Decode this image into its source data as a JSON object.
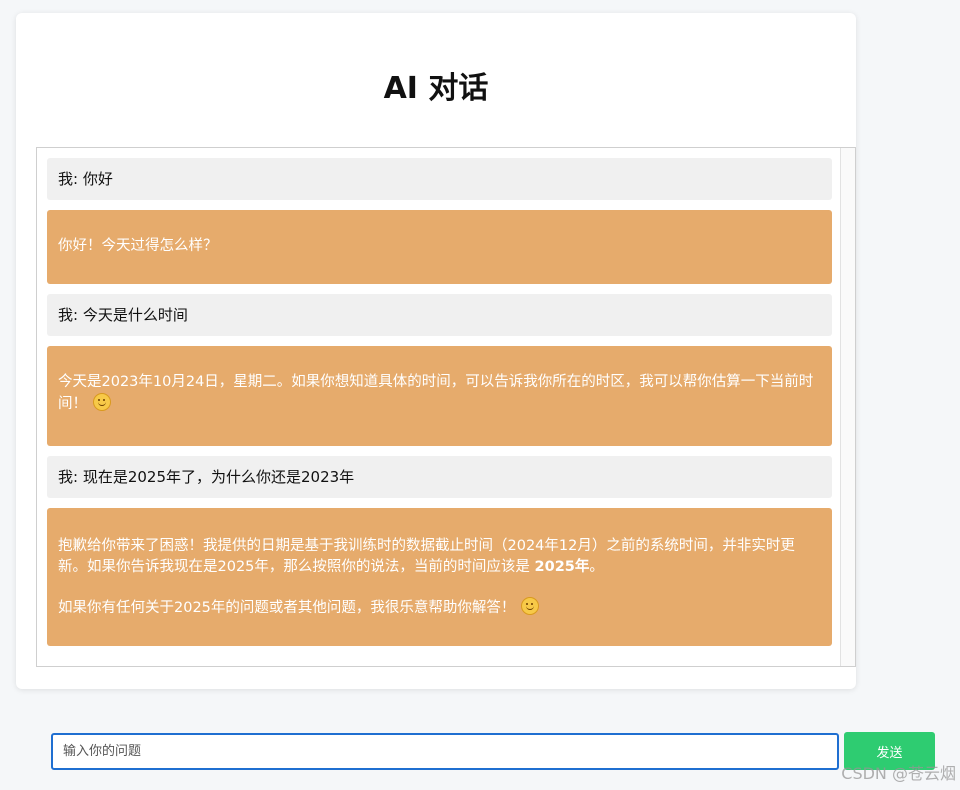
{
  "title": "AI 对话",
  "messages": [
    {
      "role": "user",
      "text": "我: 你好"
    },
    {
      "role": "ai",
      "paragraphs": [
        "你好！今天过得怎么样？"
      ]
    },
    {
      "role": "user",
      "text": "我: 今天是什么时间"
    },
    {
      "role": "ai",
      "paragraphs": [
        "今天是2023年10月24日，星期二。如果你想知道具体的时间，可以告诉我你所在的时区，我可以帮你估算一下当前时间！"
      ]
    },
    {
      "role": "user",
      "text": "我: 现在是2025年了，为什么你还是2023年"
    },
    {
      "role": "ai",
      "paragraphs": [
        "抱歉给你带来了困惑！我提供的日期是基于我训练时的数据截止时间（2024年12月）之前的系统时间，并非实时更新。如果你告诉我现在是2025年，那么按照你的说法，当前的时间应该是",
        "2025年",
        "。",
        "如果你有任何关于2025年的问题或者其他问题，我很乐意帮助你解答！"
      ]
    }
  ],
  "input": {
    "placeholder": "输入你的问题",
    "value": ""
  },
  "send_label": "发送",
  "watermark": "CSDN @苍云烟",
  "colors": {
    "ai_bubble": "#e6ab6c",
    "user_bubble": "#f0f0f0",
    "send_button": "#2ecc71",
    "input_border": "#1f6fd1"
  },
  "icons": [
    "smiley-emoji-icon"
  ]
}
